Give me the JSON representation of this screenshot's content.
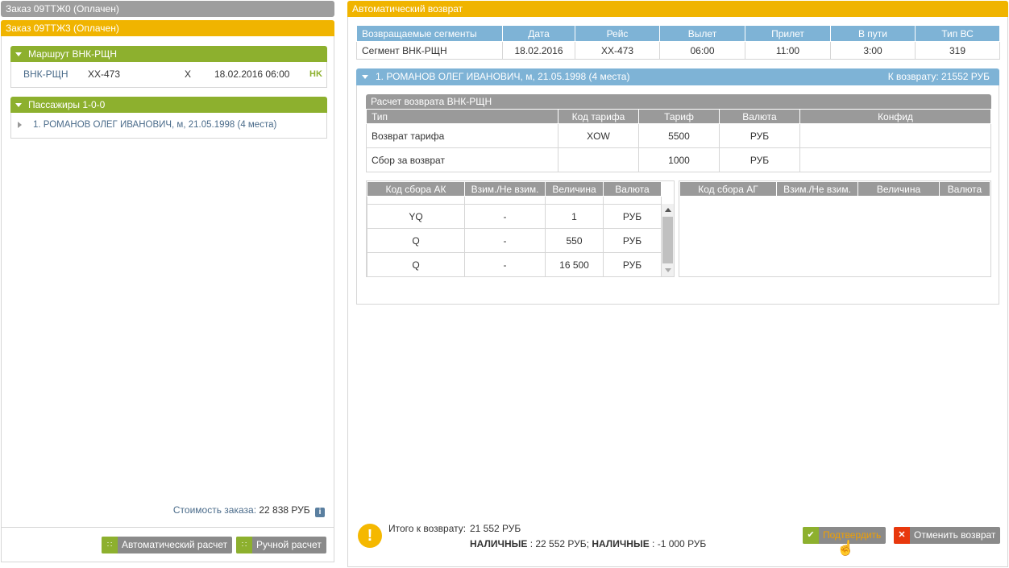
{
  "orders": [
    {
      "label": "Заказ 09ТТЖ0 (Оплачен)"
    },
    {
      "label": "Заказ 09ТТЖ3 (Оплачен)"
    }
  ],
  "route": {
    "title": "Маршрут ВНК-РЩН",
    "segment": "ВНК-РЩН",
    "flight": "XX-473",
    "class": "X",
    "datetime": "18.02.2016 06:00",
    "status": "HK"
  },
  "passengers": {
    "title": "Пассажиры 1-0-0",
    "items": [
      "1. РОМАНОВ ОЛЕГ ИВАНОВИЧ, м, 21.05.1998 (4 места)"
    ]
  },
  "cost": {
    "label": "Стоимость заказа:",
    "value": "22 838 РУБ",
    "icon": "info-icon"
  },
  "left_buttons": {
    "auto": "Автоматический расчет",
    "manual": "Ручной расчет"
  },
  "right": {
    "title": "Автоматический возврат",
    "segments": {
      "headers": [
        "Возвращаемые сегменты",
        "Дата",
        "Рейс",
        "Вылет",
        "Прилет",
        "В пути",
        "Тип ВС"
      ],
      "rows": [
        [
          "Сегмент ВНК-РЩН",
          "18.02.2016",
          "XX-473",
          "06:00",
          "11:00",
          "3:00",
          "319"
        ]
      ]
    },
    "passenger_bar": {
      "name": "1. РОМАНОВ ОЛЕГ ИВАНОВИЧ, м, 21.05.1998 (4 места)",
      "refund": "К возврату: 21552 РУБ"
    },
    "calc": {
      "title": "Расчет возврата ВНК-РЩН",
      "headers": [
        "Тип",
        "Код тарифа",
        "Тариф",
        "Валюта",
        "Конфид"
      ],
      "rows": [
        [
          "Возврат тарифа",
          "XOW",
          "5500",
          "РУБ",
          ""
        ],
        [
          "Сбор за возврат",
          "",
          "1000",
          "РУБ",
          ""
        ]
      ]
    },
    "ak": {
      "headers": [
        "Код сбора АК",
        "Взим./Не взим.",
        "Величина",
        "Валюта"
      ],
      "rows": [
        [
          "YQ",
          "-",
          "1",
          "РУБ"
        ],
        [
          "Q",
          "-",
          "550",
          "РУБ"
        ],
        [
          "Q",
          "-",
          "16 500",
          "РУБ"
        ]
      ]
    },
    "ag": {
      "headers": [
        "Код сбора АГ",
        "Взим./Не взим.",
        "Величина",
        "Валюта"
      ]
    },
    "totals": {
      "label": "Итого к возврату:",
      "value": "21 552 РУБ",
      "cash1_label": "НАЛИЧНЫЕ",
      "cash1_value": " : 22 552 РУБ; ",
      "cash2_label": "НАЛИЧНЫЕ",
      "cash2_value": " : -1 000 РУБ"
    },
    "buttons": {
      "confirm": "Подтвердить",
      "cancel": "Отменить возврат"
    }
  }
}
